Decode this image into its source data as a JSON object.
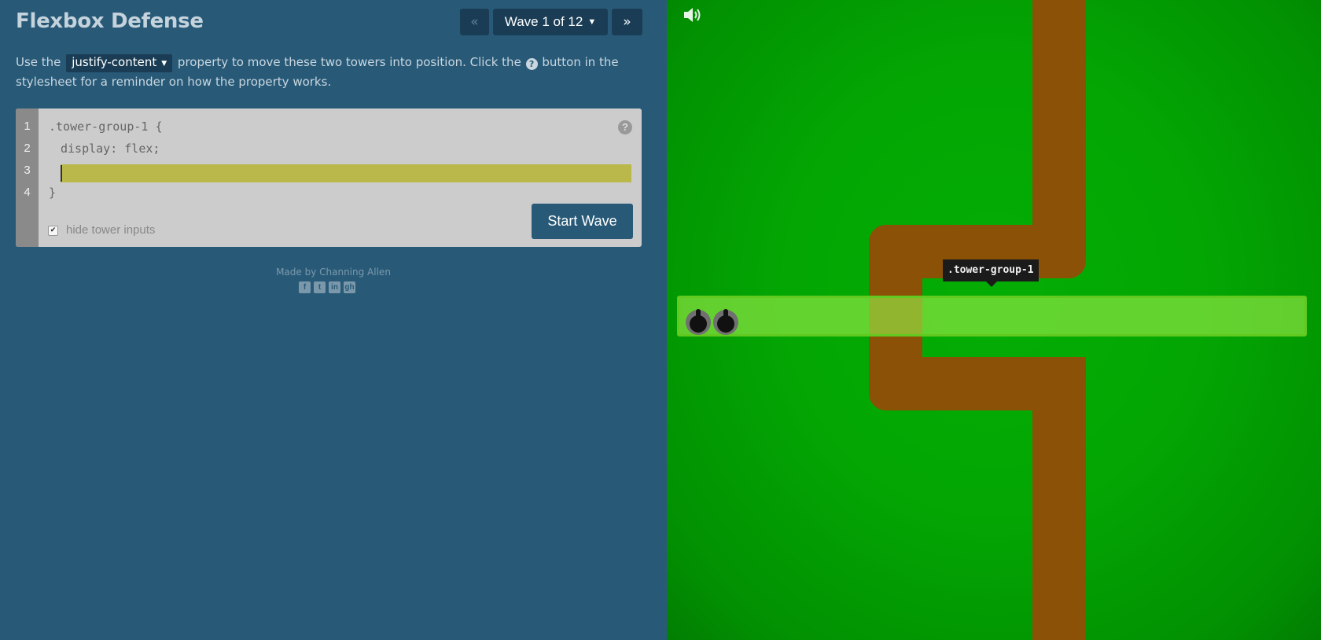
{
  "header": {
    "title": "Flexbox Defense",
    "prev_label": "«",
    "wave_label": "Wave 1 of 12",
    "next_label": "»"
  },
  "instructions": {
    "before": "Use the",
    "property": "justify-content",
    "middle": "property to move these two towers into position. Click the",
    "help_glyph": "?",
    "after": "button in the stylesheet for a reminder on how the property works."
  },
  "editor": {
    "line_numbers": [
      "1",
      "2",
      "3",
      "4"
    ],
    "line1": ".tower-group-1 {",
    "line2": "display: flex;",
    "input_value": "",
    "line4": "}",
    "help_glyph": "?",
    "hide_inputs_label": "hide tower inputs",
    "hide_inputs_checked": true,
    "start_label": "Start Wave"
  },
  "footer": {
    "credit": "Made by Channing Allen",
    "social_icons": [
      "facebook-icon",
      "twitter-icon",
      "linkedin-icon",
      "github-icon"
    ],
    "social_glyphs": [
      "f",
      "t",
      "in",
      "gh"
    ]
  },
  "board": {
    "group_tag": ".tower-group-1",
    "tower_count": 2,
    "colors": {
      "grass": "#03a603",
      "path": "#8b5207",
      "group_highlight": "#96eb46",
      "tag_bg": "#1b1b1b"
    }
  }
}
